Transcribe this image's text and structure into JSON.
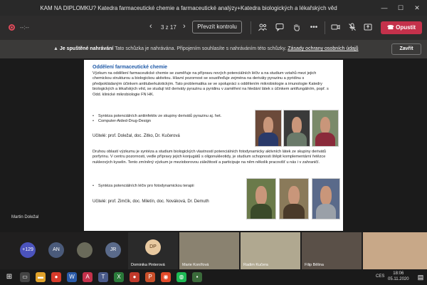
{
  "window": {
    "title": "KAM NA DIPLOMKU? Katedra farmaceutické chemie a farmaceutické analýzy+Katedra biologických a lékařských věd",
    "minimize": "—",
    "maximize": "☐",
    "close": "✕"
  },
  "toolbar": {
    "timer": "--:--",
    "prev": "‹",
    "next": "›",
    "page": "3 z 17",
    "take_control_label": "Převzít kontrolu",
    "leave_label": "Opustit"
  },
  "banner": {
    "status": "Je spuštěné nahrávání",
    "message": "Tato schůzka je nahrávána. Připojením souhlasíte s nahráváním této schůzky.",
    "link": "Zásady ochrany osobních údajů",
    "close_label": "Zavřít"
  },
  "slide": {
    "title": "Oddělení farmaceutické chemie",
    "para1": "Výzkum na oddělení farmaceutické chemie se zaměřuje na přípravu nových potenciálních léčiv a na studium vztahů mezi jejich chemickou strukturou a biologickou aktivitou. Hlavní pozornost se soustřeďuje zejména na deriváty pyrazinu a pyridinu s předpokládaným účinkem antituberkulotickým. Tato problematika se ve spolupráci s oddělením mikrobiologie a imunologie Katedry biologických a lékařských věd, se studují též deriváty pyrazinu a pyridinu v zaměření na hledání látek s účinkem antifungálním, popř. s Odd. klinické mikrobiologie FN HK.",
    "bullets1": [
      "Syntéza potenciálních antiinfektiv ze skupiny derivátů pyrazinu aj. het.",
      "Computer-Aided-Drug-Design"
    ],
    "teachers1": "Učitelé: prof. Doležal, doc. Zitko, Dr. Kučerová",
    "para2": "Druhou oblastí výzkumu je syntéza a studium biologických vlastností potenciálních fotodynamicky aktivních látek ze skupiny derivátů porfyrinu. V centru pozornosti, vedle přípravy jejich konjugátů s oligonukleotidy, je studium schopnosti štěpit komplementární řetězce nukleových kyselin. Tento zmíněný výzkum je mezioborovou záležitostí a participuje na něm několik pracovišť u nás i v zahraničí.",
    "bullets2": [
      "Syntéza potenciálních léčiv pro fotodynamickou terapii"
    ],
    "teachers2": "Učitelé: prof. Zimčík, doc. Miletín, doc. Nováková, Dr. Demuth"
  },
  "presenter": "Martin Doležal",
  "participants": {
    "more_count": "+129",
    "avatars": [
      {
        "initials": "AN",
        "color": "#4a5a7a"
      },
      {
        "initials": "JR",
        "color": "#5a6a8a"
      },
      {
        "initials": "DP",
        "color": "#e8c9a0"
      }
    ],
    "tiles": [
      {
        "name": "Dominika Pinterová"
      },
      {
        "name": "Marie Konířová"
      },
      {
        "name": "Radim Kučera"
      },
      {
        "name": "Filip Bělina"
      },
      {
        "name": ""
      }
    ]
  },
  "taskbar": {
    "lang": "CES",
    "time": "18:06",
    "date": "05.11.2020"
  }
}
